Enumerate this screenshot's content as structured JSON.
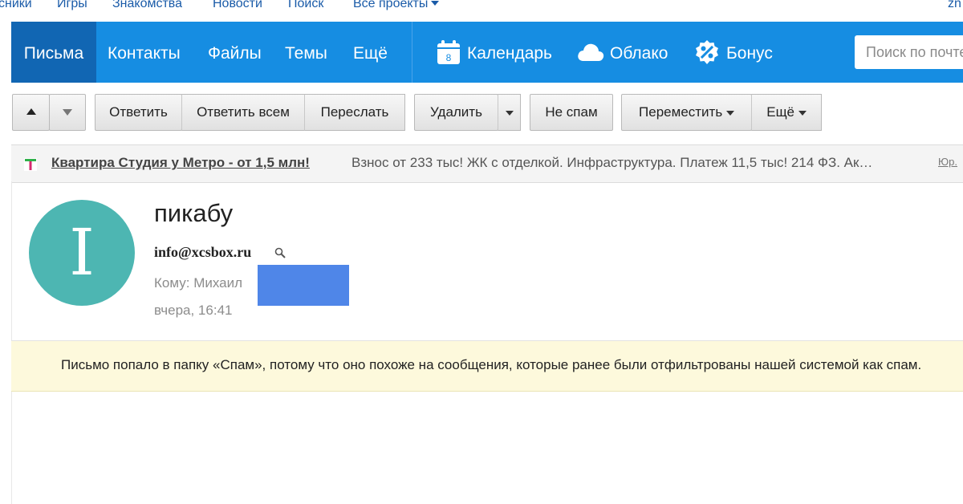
{
  "portal_bar": {
    "items": [
      "сники",
      "Игры",
      "Знакомства",
      "Новости",
      "Поиск",
      "Все проекты"
    ],
    "user": "zn"
  },
  "nav": {
    "tabs": [
      "Письма",
      "Контакты",
      "Файлы",
      "Темы",
      "Ещё"
    ],
    "services": [
      {
        "label": "Календарь",
        "icon": "calendar-icon",
        "badge": "8"
      },
      {
        "label": "Облако",
        "icon": "cloud-icon"
      },
      {
        "label": "Бонус",
        "icon": "bonus-icon"
      }
    ],
    "search_placeholder": "Поиск по почте"
  },
  "toolbar": {
    "reply": "Ответить",
    "reply_all": "Ответить всем",
    "forward": "Переслать",
    "delete": "Удалить",
    "not_spam": "Не спам",
    "move": "Переместить",
    "more": "Ещё"
  },
  "ad": {
    "title": "Квартира Студия у Метро - от 1,5 млн!",
    "text": "Взнос от 233 тыс! ЖК с отделкой. Инфраструктура. Платеж 11,5 тыс! 214 ФЗ. Ак…",
    "legal": "Юр."
  },
  "message": {
    "avatar_letter": "I",
    "subject": "пикабу",
    "sender": "info@xcsbox.ru",
    "to_label": "Кому:",
    "to_name": "Михаил",
    "date": "вчера, 16:41",
    "spam_notice": "Письмо попало в папку «Спам», потому что оно похоже на сообщения, которые ранее были отфильтрованы нашей системой как спам."
  },
  "colors": {
    "nav_bg": "#168de2",
    "nav_active": "#1166b3",
    "avatar_bg": "#4db6b2",
    "spam_bg": "#fdf9dc",
    "redaction": "#4f86e8"
  }
}
